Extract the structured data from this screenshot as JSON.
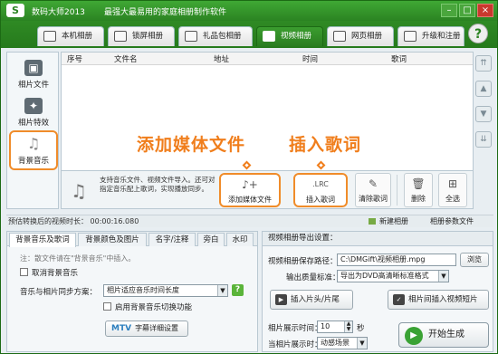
{
  "app": {
    "logo": "S",
    "title": "数码大师2013",
    "slogan": "最强大最易用的家庭相册制作软件"
  },
  "window": {
    "minimize": "–",
    "maximize": "□",
    "close": "×"
  },
  "tabs": [
    {
      "label": "本机相册"
    },
    {
      "label": "锁屏相册"
    },
    {
      "label": "礼品包相册"
    },
    {
      "label": "视频相册"
    },
    {
      "label": "网页相册"
    },
    {
      "label": "升级和注册"
    }
  ],
  "help": "?",
  "sidebar": [
    {
      "label": "相片文件",
      "icon": "▣"
    },
    {
      "label": "相片特效",
      "icon": "✦"
    },
    {
      "label": "背景音乐",
      "icon": "♫"
    }
  ],
  "list": {
    "columns": [
      "序号",
      "文件名",
      "地址",
      "时间",
      "歌词"
    ]
  },
  "scroll_buttons": [
    "⇈",
    "▲",
    "▼",
    "⇊"
  ],
  "annotations": {
    "add_media": "添加媒体文件",
    "insert_lyrics": "插入歌词"
  },
  "toolbar": {
    "tip": "支持音乐文件、视频文件导入。还可对指定音乐配上歌词，实现播放同步。",
    "add_media": "添加媒体文件",
    "insert_lyrics": "插入歌词",
    "lrc_icon": ".LRC",
    "clear_lyrics": "清除歌词",
    "delete": "删除",
    "select_all": "全选"
  },
  "status": {
    "estimate_label": "预估转换后的视频时长：",
    "estimate_value": "00:00:16.080",
    "new_album": "新建相册",
    "album_params": "相册参数文件"
  },
  "music_panel": {
    "tabs": [
      "背景音乐及歌词",
      "背景颜色及图片",
      "名字/注释",
      "旁白",
      "水印"
    ],
    "note": "注：散文件请在\"背景音乐\"中插入。",
    "cancel_bg_music": "取消背景音乐",
    "sync_label": "音乐与相片同步方案：",
    "sync_value": "相片适应音乐时间长度",
    "switch_label": "启用背景音乐切换功能",
    "mtv_prefix": "MTV",
    "mtv_label": "字幕详细设置"
  },
  "export": {
    "title": "视频相册导出设置：",
    "path_label": "视频相册保存路径：",
    "path_value": "C:\\DMGift\\视频相册.mpg",
    "browse": "浏览",
    "quality_label": "输出质量标准：",
    "quality_value": "导出为DVD高清晰标准格式",
    "insert_clip": "插入片头/片尾",
    "insert_video": "相片间插入视频短片",
    "duration_label": "相片展示时间：",
    "duration_value": "10",
    "duration_unit": "秒",
    "transition_label": "当相片展示时：",
    "transition_value": "动感场景",
    "generate": "开始生成"
  }
}
